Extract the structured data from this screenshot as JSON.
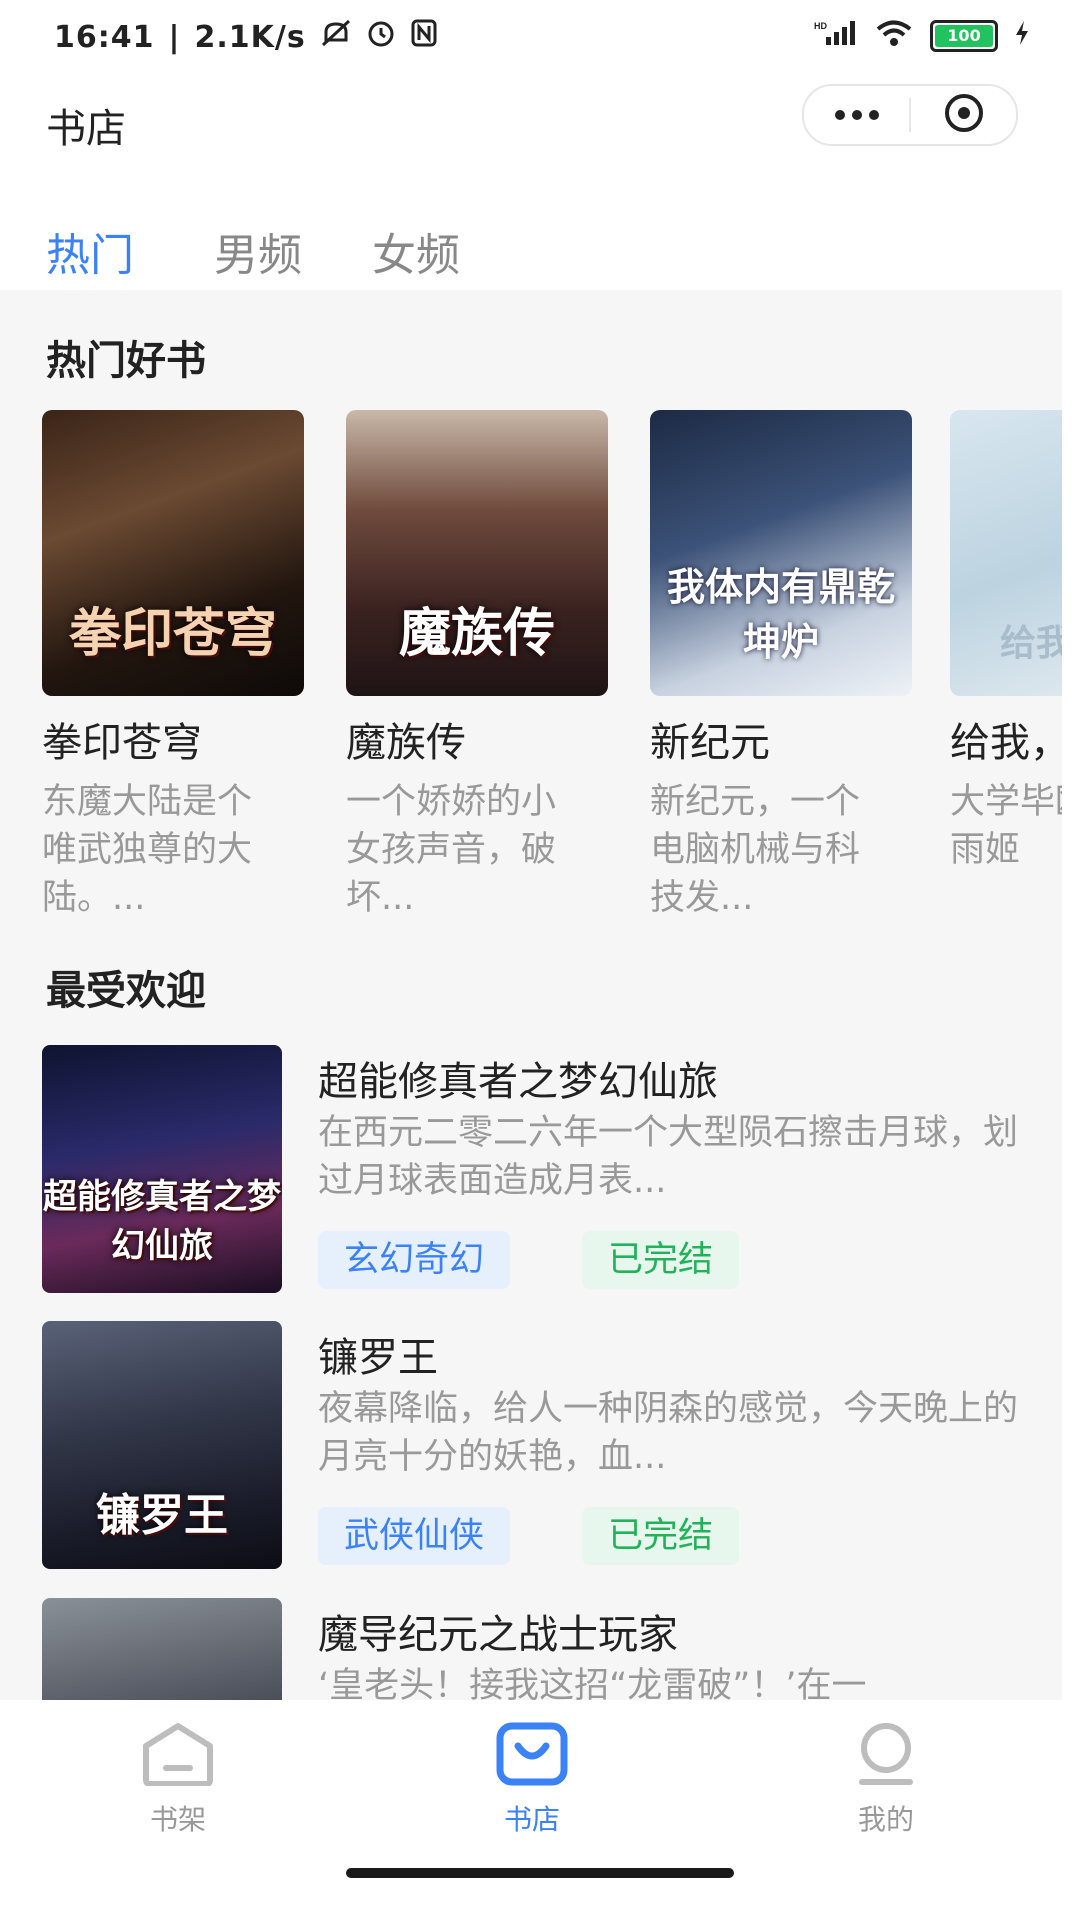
{
  "status_bar": {
    "time": "16:41",
    "speed": "2.1K/s",
    "battery": "100",
    "colors": {
      "battery": "#22c35e"
    }
  },
  "header": {
    "title": "书店",
    "more_icon": "more-dots-icon",
    "close_icon": "close-circle-icon"
  },
  "tabs": [
    {
      "label": "热门",
      "active": true
    },
    {
      "label": "男频",
      "active": false
    },
    {
      "label": "女频",
      "active": false
    }
  ],
  "hot_section": {
    "title": "热门好书",
    "books": [
      {
        "title": "拳印苍穹",
        "desc": "东魔大陆是个唯武独尊的大陆。...",
        "cover_text": "拳印苍穹"
      },
      {
        "title": "魔族传",
        "desc": "一个娇娇的小女孩声音，破坏...",
        "cover_text": "魔族传"
      },
      {
        "title": "新纪元",
        "desc": "新纪元，一个电脑机械与科技发...",
        "cover_text": "我体内有鼎乾坤炉"
      },
      {
        "title": "给我，",
        "desc": "大学毕欧阳沈雨姬",
        "cover_text": "给我"
      }
    ]
  },
  "popular_section": {
    "title": "最受欢迎",
    "books": [
      {
        "title": "超能修真者之梦幻仙旅",
        "desc": "在西元二零二六年一个大型陨石擦击月球，划过月球表面造成月表...",
        "genre": "玄幻奇幻",
        "status": "已完结",
        "cover_text": "超能修真者之梦幻仙旅"
      },
      {
        "title": "镰罗王",
        "desc": "夜幕降临，给人一种阴森的感觉，今天晚上的月亮十分的妖艳，血...",
        "genre": "武侠仙侠",
        "status": "已完结",
        "cover_text": "镰罗王"
      },
      {
        "title": "魔导纪元之战士玩家",
        "desc": "‘皇老头！接我这招“龙雷破”！’在一",
        "genre": "",
        "status": "",
        "cover_text": ""
      }
    ]
  },
  "bottom_nav": [
    {
      "label": "书架",
      "icon": "bookshelf-icon",
      "active": false
    },
    {
      "label": "书店",
      "icon": "store-bag-icon",
      "active": true
    },
    {
      "label": "我的",
      "icon": "profile-icon",
      "active": false
    }
  ],
  "colors": {
    "accent": "#3b82f6",
    "tag_genre_bg": "#e6f0fd",
    "tag_status_text": "#22b25a",
    "tag_status_bg": "#e7f7ee"
  }
}
